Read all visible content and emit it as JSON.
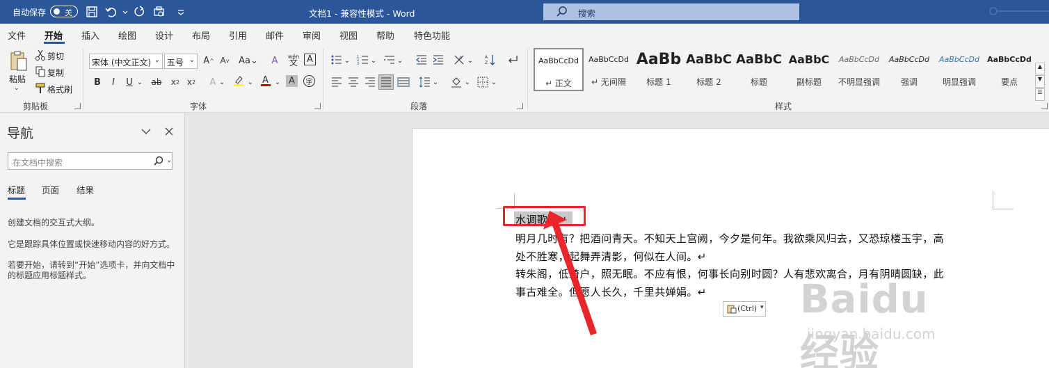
{
  "titlebar": {
    "autosave_label": "自动保存",
    "autosave_state": "关",
    "document_title": "文档1  -  兼容性模式  -  Word",
    "search_label": "搜索"
  },
  "tabs": [
    "文件",
    "开始",
    "插入",
    "绘图",
    "设计",
    "布局",
    "引用",
    "邮件",
    "审阅",
    "视图",
    "帮助",
    "特色功能"
  ],
  "active_tab": "开始",
  "clipboard": {
    "paste": "粘贴",
    "cut": "剪切",
    "copy": "复制",
    "format_painter": "格式刷",
    "group_label": "剪贴板"
  },
  "font": {
    "font_name": "宋体 (中文正文)",
    "font_size": "五号",
    "group_label": "字体"
  },
  "paragraph": {
    "group_label": "段落"
  },
  "styles": {
    "group_label": "样式",
    "items": [
      {
        "sample": "AaBbCcDd",
        "name": "↵ 正文"
      },
      {
        "sample": "AaBbCcDd",
        "name": "↵ 无间隔"
      },
      {
        "sample": "AaBb",
        "name": "标题 1"
      },
      {
        "sample": "AaBbC",
        "name": "标题 2"
      },
      {
        "sample": "AaBbC",
        "name": "标题"
      },
      {
        "sample": "AaBbC",
        "name": "副标题"
      },
      {
        "sample": "AaBbCcDd",
        "name": "不明显强调"
      },
      {
        "sample": "AaBbCcDd",
        "name": "强调"
      },
      {
        "sample": "AaBbCcDd",
        "name": "明显强调"
      },
      {
        "sample": "AaBbCcDd",
        "name": "要点"
      }
    ]
  },
  "nav": {
    "title": "导航",
    "search_placeholder": "在文档中搜索",
    "tabs": [
      "标题",
      "页面",
      "结果"
    ],
    "p1": "创建文档的交互式大纲。",
    "p2": "它是跟踪具体位置或快速移动内容的好方式。",
    "p3": "若要开始，请转到“开始”选项卡，并向文档中的标题应用标题样式。"
  },
  "document": {
    "lines": [
      "水调歌头↵",
      "明月几时有？把酒问青天。不知天上宫阙，今夕是何年。我欲乘风归去，又恐琼楼玉宇，高",
      "处不胜寒，起舞弄清影，何似在人间。↵",
      "转朱阁，低绮户，照无眠。不应有恨，何事长向别时圆？人有悲欢离合，月有阴晴圆缺，此",
      "事古难全。但愿人长久，千里共婵娟。↵"
    ],
    "paste_options": "(Ctrl)"
  },
  "watermark": {
    "logo": "Baidu经验",
    "url": "jingyan.baidu.com"
  },
  "colors": {
    "titlebar": "#2b579a",
    "highlight": "#e8262b",
    "font_color_bar": "#d00000",
    "highlight_color_bar": "#ffff00"
  }
}
